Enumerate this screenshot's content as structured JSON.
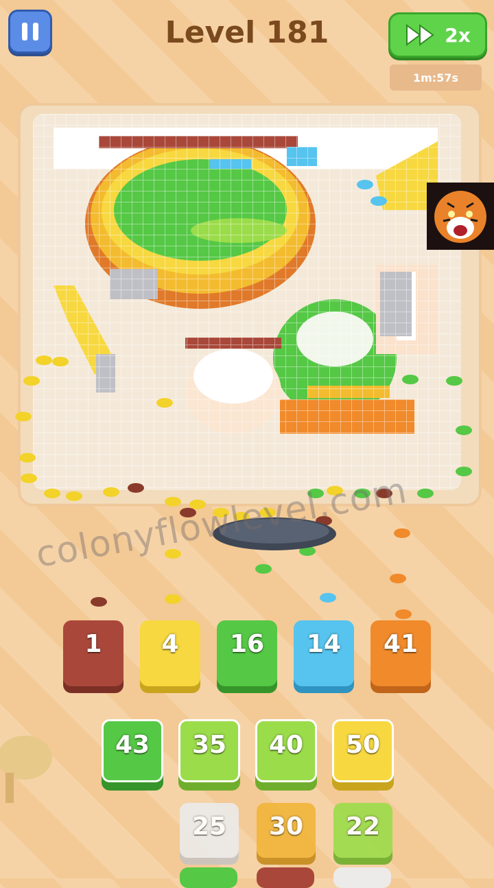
{
  "header": {
    "title": "Level 181",
    "speed_label": "2x",
    "timer": "1m:57s"
  },
  "watermark": "colonyflowlevel.com",
  "colors": {
    "brown": "#a9483a",
    "yellow": "#f7d840",
    "green": "#55c846",
    "light_green": "#9bdc4a",
    "blue": "#56c4ee",
    "orange": "#f08a2a",
    "white": "#ecebea"
  },
  "colony_tiles": [
    {
      "value": "1",
      "color": "#a9483a"
    },
    {
      "value": "4",
      "color": "#f7d840"
    },
    {
      "value": "16",
      "color": "#55c846"
    },
    {
      "value": "14",
      "color": "#56c4ee"
    },
    {
      "value": "41",
      "color": "#f08a2a"
    }
  ],
  "queue_row1": [
    {
      "value": "43",
      "color": "#55c846"
    },
    {
      "value": "35",
      "color": "#9bdc4a"
    },
    {
      "value": "40",
      "color": "#9bdc4a"
    },
    {
      "value": "50",
      "color": "#f7d840"
    }
  ],
  "queue_row2": [
    {
      "value": "25",
      "color": "#ecebea"
    },
    {
      "value": "30",
      "color": "#f2b63a"
    },
    {
      "value": "22",
      "color": "#9bdc4a"
    }
  ]
}
